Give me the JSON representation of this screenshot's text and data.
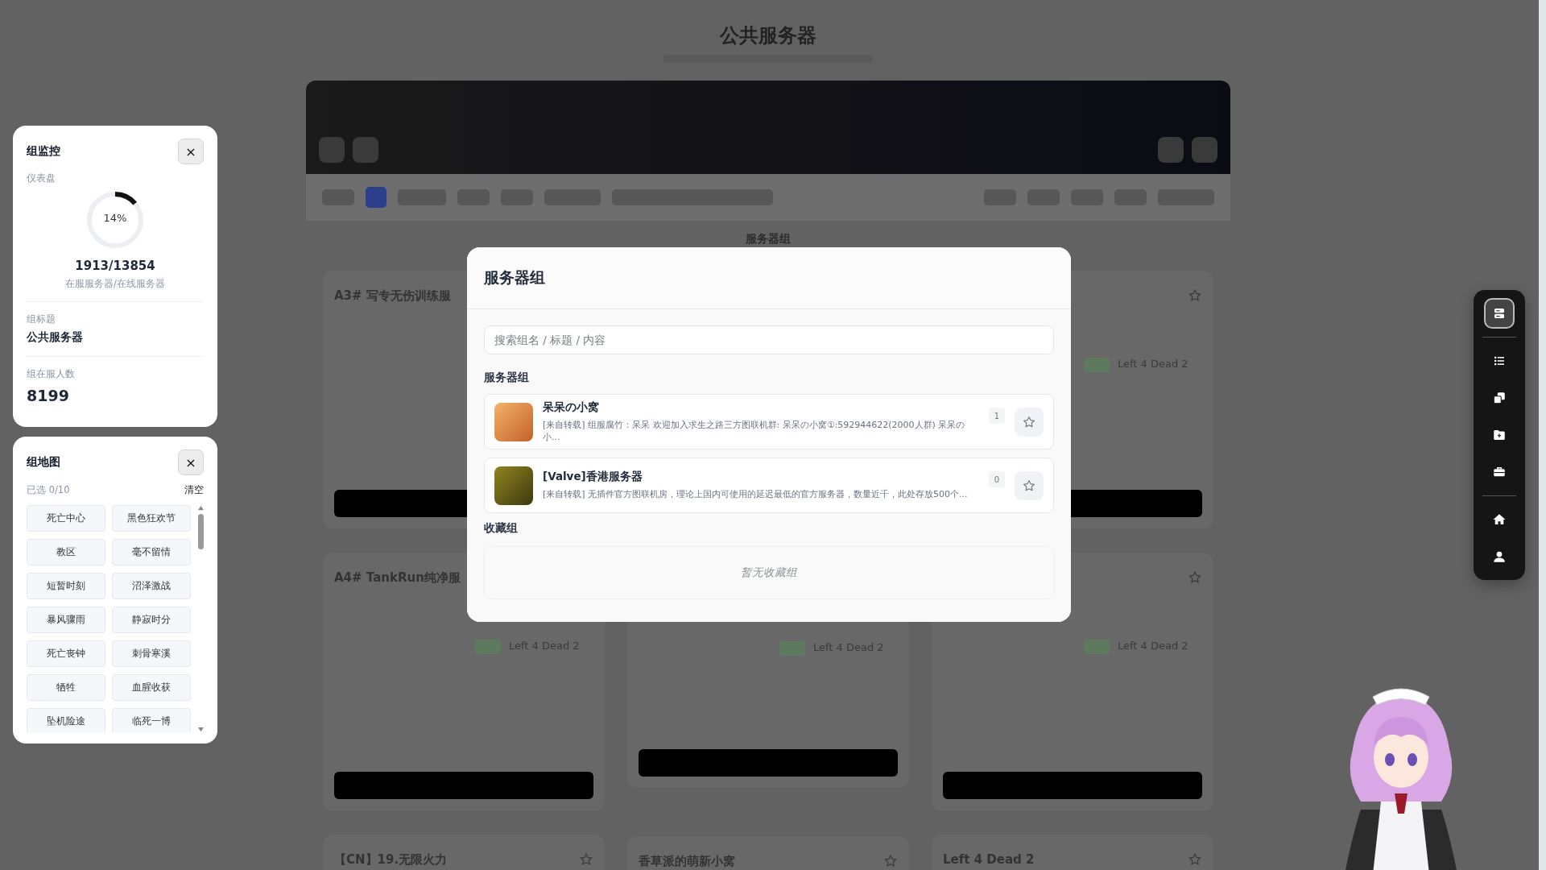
{
  "page": {
    "title": "公共服务器",
    "section_title": "服务器组",
    "card_columns": [
      [
        {
          "title": "A3# 写专无伤训练服"
        },
        {
          "title": "A4# TankRun纯净服",
          "game": "Left 4 Dead 2"
        },
        {
          "title": "【CN】19.无限火力"
        }
      ],
      [
        {
          "game": "Left 4 Dead 2"
        },
        {
          "title": "香草派的萌新小窝"
        }
      ],
      [
        {
          "game": "Left 4 Dead 2"
        },
        {
          "game": "Left 4 Dead 2"
        },
        {
          "title": "Left 4 Dead 2"
        }
      ]
    ]
  },
  "monitor": {
    "title": "组监控",
    "close": "×",
    "dashboard_label": "仪表盘",
    "gauge": {
      "level": 0.14,
      "reading": "14%"
    },
    "ratio": "1913/13854",
    "ratio_caption": "在服服务器/在线服务器",
    "group_title_label": "组标题",
    "group_title": "公共服务器",
    "players_label": "组在服人数",
    "players": "8199"
  },
  "maps": {
    "title": "组地图",
    "close": "×",
    "selected_count": "已选 0/10",
    "clear": "清空",
    "items": [
      {
        "label": "死亡中心",
        "selected": false
      },
      {
        "label": "黑色狂欢节",
        "selected": false
      },
      {
        "label": "教区",
        "selected": false
      },
      {
        "label": "毫不留情",
        "selected": false
      },
      {
        "label": "短暂时刻",
        "selected": false
      },
      {
        "label": "沼泽激战",
        "selected": false
      },
      {
        "label": "暴风骤雨",
        "selected": false
      },
      {
        "label": "静寂时分",
        "selected": false
      },
      {
        "label": "死亡丧钟",
        "selected": false
      },
      {
        "label": "刺骨寒溪",
        "selected": false
      },
      {
        "label": "牺牲",
        "selected": false
      },
      {
        "label": "血腥收获",
        "selected": false
      },
      {
        "label": "坠机险途",
        "selected": false
      },
      {
        "label": "临死一博",
        "selected": false
      }
    ]
  },
  "modal": {
    "title": "服务器组",
    "search": {
      "placeholder": "搜索组名 / 标题 / 内容"
    },
    "groups_heading": "服务器组",
    "groups": [
      {
        "name": "呆呆の小窝",
        "description": "[来自转载] 组服腐竹：呆呆 欢迎加入求生之路三方图联机群: 呆呆の小窝①:592944622(2000人群) 呆呆の小...",
        "count": "1",
        "starred": false
      },
      {
        "name": "[Valve]香港服务器",
        "description": "[来自转载] 无插件官方图联机房，理论上国内可使用的延迟最低的官方服务器，数量近千，此处存放500个...",
        "count": "0",
        "starred": false
      }
    ],
    "favorites_heading": "收藏组",
    "favorites_empty": "暂无收藏组"
  },
  "dock": {
    "groups": [
      [
        {
          "kind": "servers",
          "selected": true
        }
      ],
      [
        {
          "kind": "list",
          "selected": false
        },
        {
          "kind": "copy",
          "selected": false
        },
        {
          "kind": "folder-plus",
          "selected": false
        },
        {
          "kind": "toolbox",
          "selected": false
        }
      ],
      [
        {
          "kind": "home",
          "selected": false
        },
        {
          "kind": "user",
          "selected": false
        }
      ]
    ]
  }
}
